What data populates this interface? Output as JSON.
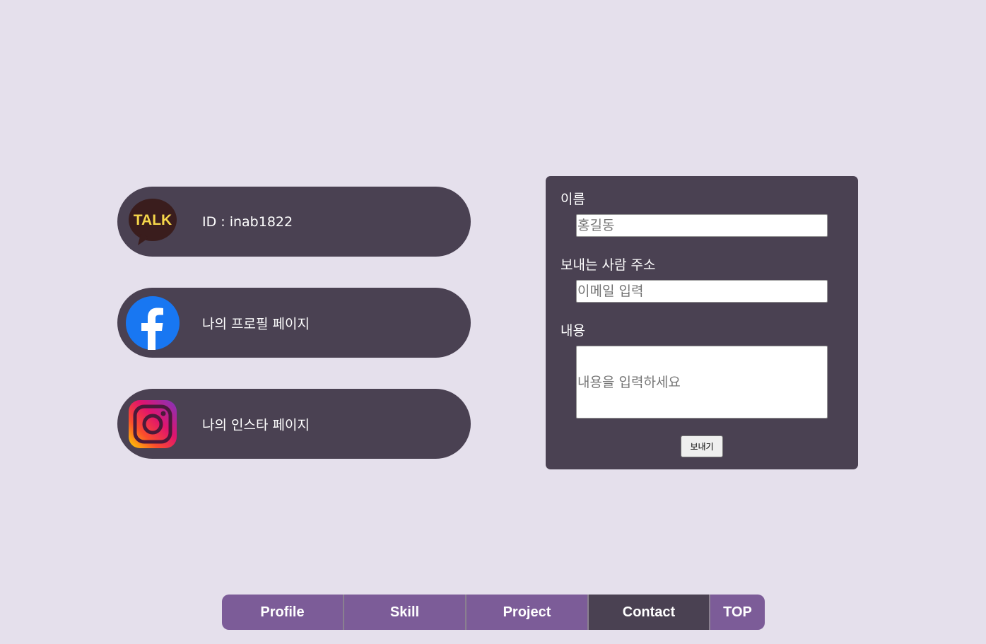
{
  "contacts": [
    {
      "label": "ID : inab1822",
      "icon": "kakaotalk-icon",
      "icon_text": "TALK"
    },
    {
      "label": "나의 프로필 페이지",
      "icon": "facebook-icon"
    },
    {
      "label": "나의 인스타 페이지",
      "icon": "instagram-icon"
    }
  ],
  "form": {
    "name_label": "이름",
    "name_placeholder": "홍길동",
    "email_label": "보내는 사람 주소",
    "email_placeholder": "이메일 입력",
    "message_label": "내용",
    "message_placeholder": "내용을 입력하세요",
    "submit_label": "보내기"
  },
  "nav": {
    "items": [
      {
        "label": "Profile",
        "active": false
      },
      {
        "label": "Skill",
        "active": false
      },
      {
        "label": "Project",
        "active": false
      },
      {
        "label": "Contact",
        "active": true
      },
      {
        "label": "TOP",
        "active": false
      }
    ]
  },
  "colors": {
    "background": "#e5e0ec",
    "panel": "#4a4152",
    "nav_inactive": "#7c5c98",
    "nav_active": "#4a4152"
  }
}
